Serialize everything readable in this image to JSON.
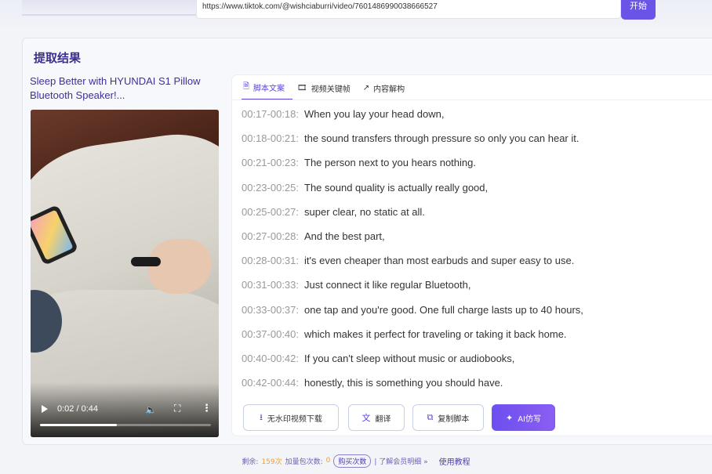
{
  "search": {
    "url_value": "https://www.tiktok.com/@wishciaburri/video/7601486990038666527",
    "start_label": "开始"
  },
  "panel": {
    "title": "提取结果",
    "video_title": "Sleep Better with HYUNDAI S1 Pillow Bluetooth Speaker!...",
    "player": {
      "time": "0:02 / 0:44",
      "progress_fraction": 0.45
    }
  },
  "tabs": [
    {
      "label": "脚本文案",
      "icon": "document-icon",
      "active": true
    },
    {
      "label": "视频关键帧",
      "icon": "film-icon",
      "active": false
    },
    {
      "label": "内容解构",
      "icon": "trend-icon",
      "active": false
    }
  ],
  "transcript": [
    {
      "time": "00:17-00:18:",
      "text": "When you lay your head down,"
    },
    {
      "time": "00:18-00:21:",
      "text": "the sound transfers through pressure so only you can hear it."
    },
    {
      "time": "00:21-00:23:",
      "text": "The person next to you hears nothing."
    },
    {
      "time": "00:23-00:25:",
      "text": "The sound quality is actually really good,"
    },
    {
      "time": "00:25-00:27:",
      "text": "super clear, no static at all."
    },
    {
      "time": "00:27-00:28:",
      "text": "And the best part,"
    },
    {
      "time": "00:28-00:31:",
      "text": "it's even cheaper than most earbuds and super easy to use."
    },
    {
      "time": "00:31-00:33:",
      "text": "Just connect it like regular Bluetooth,"
    },
    {
      "time": "00:33-00:37:",
      "text": "one tap and you're good. One full charge lasts up to 40 hours,"
    },
    {
      "time": "00:37-00:40:",
      "text": "which makes it perfect for traveling or taking it back home."
    },
    {
      "time": "00:40-00:42:",
      "text": "If you can't sleep without music or audiobooks,"
    },
    {
      "time": "00:42-00:44:",
      "text": "honestly, this is something you should have."
    }
  ],
  "actions": {
    "download": "无水印视频下载",
    "translate": "翻译",
    "copy": "复制脚本",
    "ai": "AI仿写"
  },
  "footer": {
    "remaining_label": "剩余:",
    "remaining_value": "159次",
    "pack_label": "加量包次数:",
    "pack_value": "0",
    "buy": "购买次数",
    "member": "| 了解会员明细 »",
    "help": "使用教程"
  },
  "colors": {
    "accent": "#5b45d8",
    "primary_button": "#6d4ff0",
    "orange": "#e8a23a"
  }
}
